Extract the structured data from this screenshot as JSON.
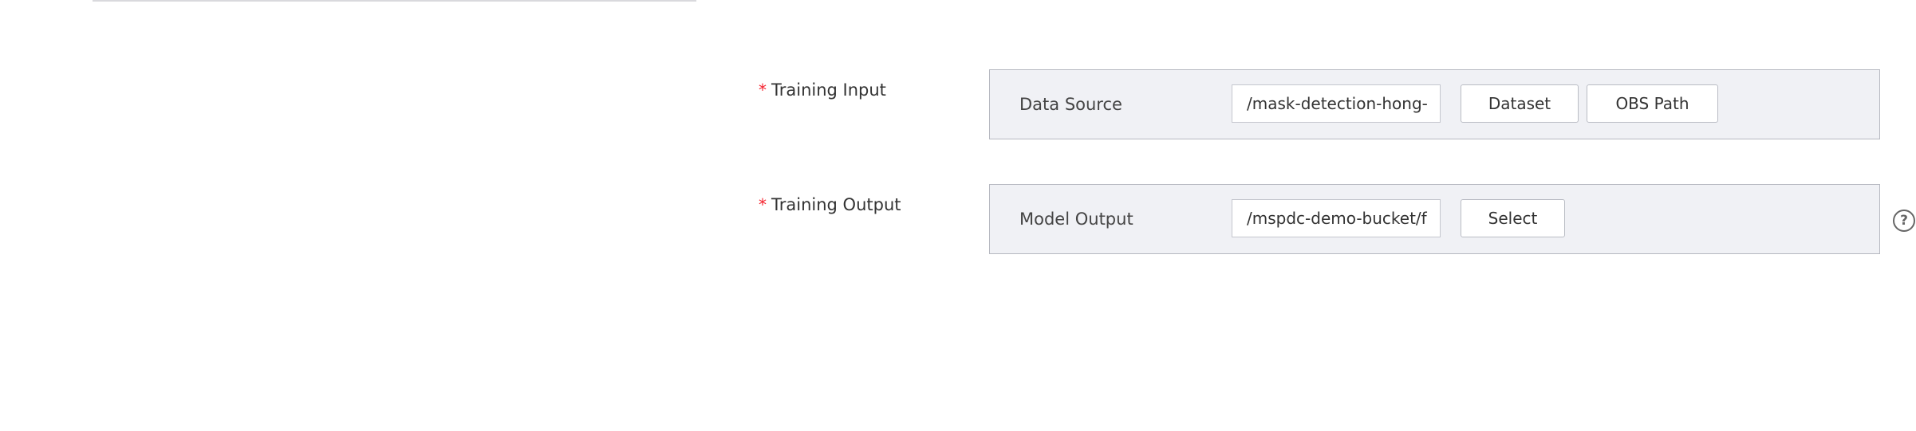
{
  "form": {
    "training_input": {
      "label": "Training Input",
      "required_mark": "*",
      "panel_label": "Data Source",
      "path_value": "/mask-detection-hong-",
      "buttons": {
        "dataset": "Dataset",
        "obs_path": "OBS Path"
      }
    },
    "training_output": {
      "label": "Training Output",
      "required_mark": "*",
      "panel_label": "Model Output",
      "path_value": "/mspdc-demo-bucket/f",
      "buttons": {
        "select": "Select"
      },
      "help_icon": "?"
    }
  },
  "icons": {
    "help": "question-circle-icon"
  },
  "colors": {
    "required": "#f5222d",
    "panel_bg": "#f0f1f5",
    "panel_border": "#b6b8c0"
  }
}
